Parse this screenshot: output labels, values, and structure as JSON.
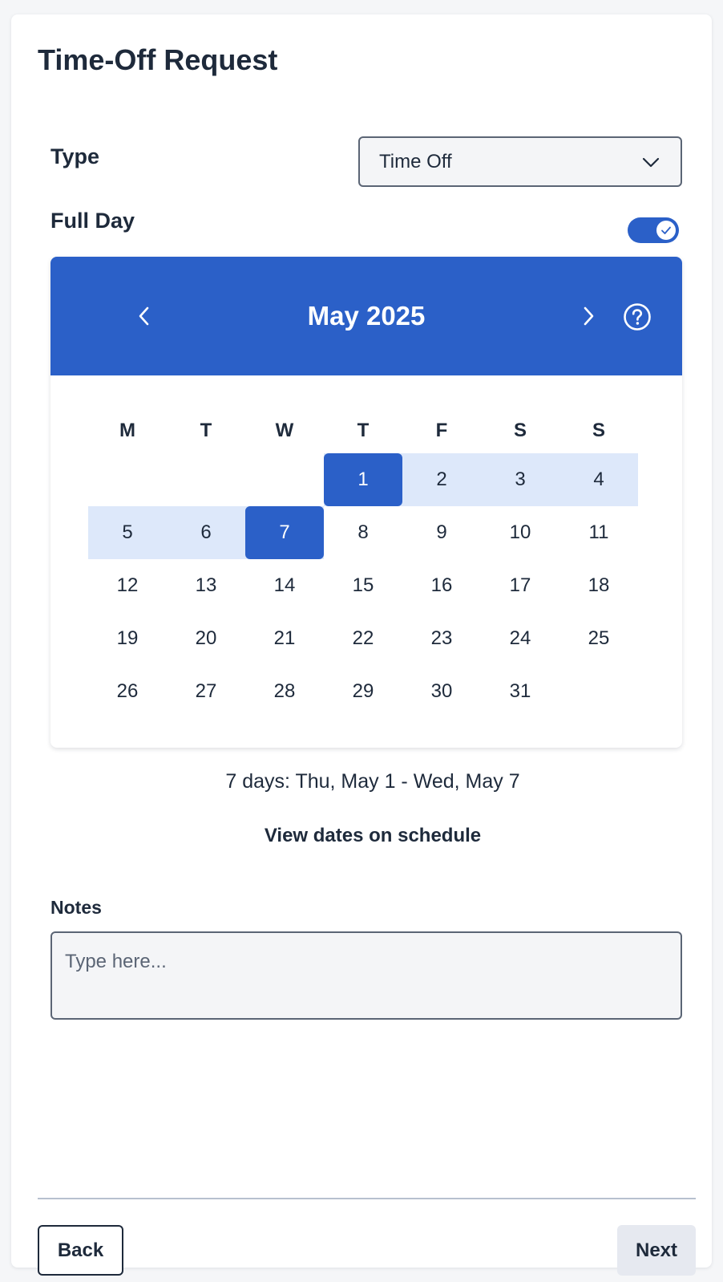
{
  "page": {
    "title": "Time-Off Request"
  },
  "type_field": {
    "label": "Type",
    "value": "Time Off"
  },
  "full_day": {
    "label": "Full Day",
    "on": true
  },
  "calendar": {
    "month_label": "May 2025",
    "weekdays": [
      "M",
      "T",
      "W",
      "T",
      "F",
      "S",
      "S"
    ],
    "weeks": [
      [
        "",
        "",
        "",
        "1",
        "2",
        "3",
        "4"
      ],
      [
        "5",
        "6",
        "7",
        "8",
        "9",
        "10",
        "11"
      ],
      [
        "12",
        "13",
        "14",
        "15",
        "16",
        "17",
        "18"
      ],
      [
        "19",
        "20",
        "21",
        "22",
        "23",
        "24",
        "25"
      ],
      [
        "26",
        "27",
        "28",
        "29",
        "30",
        "31",
        ""
      ]
    ],
    "range_start": 1,
    "range_end": 7
  },
  "summary": {
    "range_text": "7 days: Thu, May 1 - Wed, May 7",
    "view_link": "View dates on schedule"
  },
  "notes": {
    "label": "Notes",
    "placeholder": "Type here...",
    "value": ""
  },
  "footer": {
    "back_label": "Back",
    "next_label": "Next"
  },
  "colors": {
    "accent": "#2b60c8",
    "range_fill": "#dde8fa",
    "text": "#1e2a3b"
  },
  "icons": {
    "type_dropdown": "chevron-down-icon",
    "prev_month": "chevron-left-icon",
    "next_month": "chevron-right-icon",
    "help": "help-circle-icon",
    "toggle_check": "check-icon"
  }
}
